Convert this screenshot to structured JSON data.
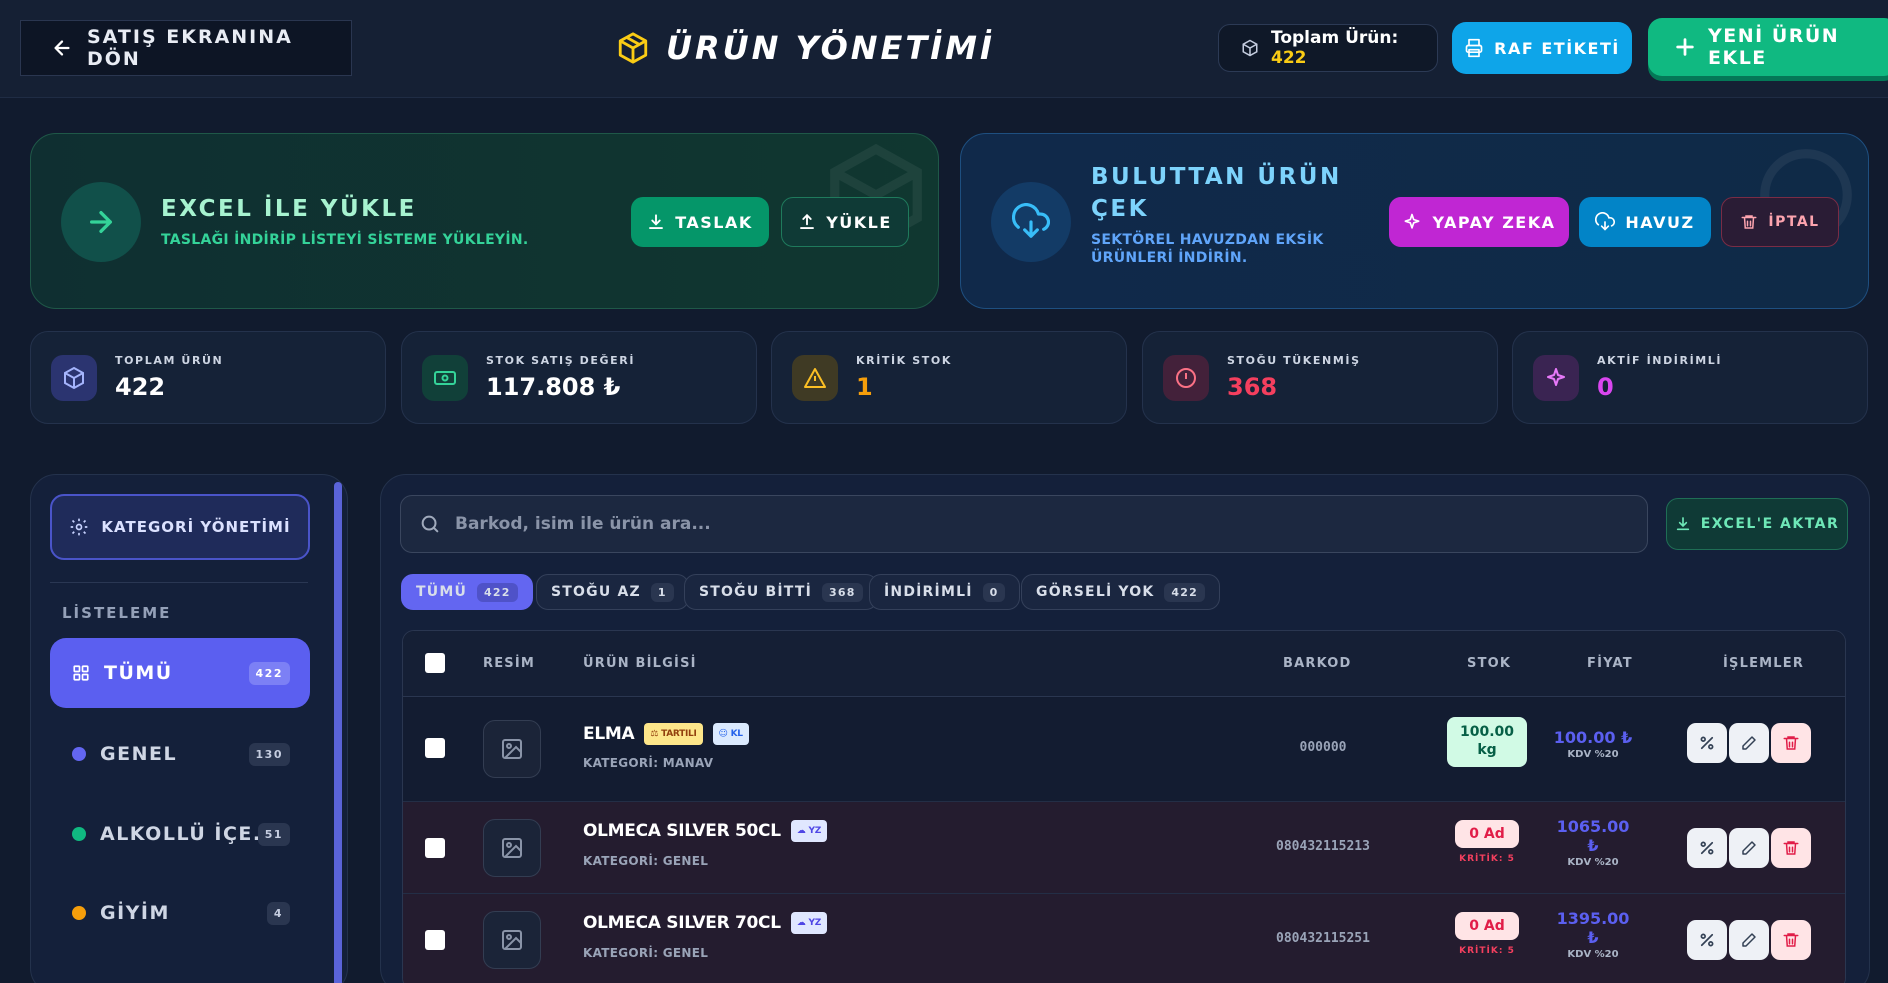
{
  "header": {
    "back_label": "SATIŞ EKRANINA DÖN",
    "title": "ÜRÜN YÖNETİMİ",
    "total_label": "Toplam Ürün:",
    "total_value": "422",
    "shelf_label": "RAF ETİKETİ",
    "new_label": "YENİ ÜRÜN EKLE"
  },
  "excel_banner": {
    "title": "EXCEL İLE YÜKLE",
    "subtitle": "TASLAĞI İNDİRİP LİSTEYİ SİSTEME YÜKLEYİN.",
    "template_label": "TASLAK",
    "upload_label": "YÜKLE"
  },
  "cloud_banner": {
    "title_line1": "BULUTTAN ÜRÜN",
    "title_line2": "ÇEK",
    "subtitle_line1": "SEKTÖREL HAVUZDAN EKSİK",
    "subtitle_line2": "ÜRÜNLERİ İNDİRİN.",
    "ai_label": "YAPAY ZEKA",
    "pool_label": "HAVUZ",
    "cancel_label": "İPTAL"
  },
  "stats": [
    {
      "label": "TOPLAM ÜRÜN",
      "value": "422",
      "icon": "cube-icon",
      "color": "#ffffff"
    },
    {
      "label": "STOK SATIŞ DEĞERİ",
      "value": "117.808 ₺",
      "icon": "money-icon",
      "color": "#ffffff"
    },
    {
      "label": "KRİTİK STOK",
      "value": "1",
      "icon": "warning-icon",
      "color": "#f59e0b"
    },
    {
      "label": "STOĞU TÜKENMİŞ",
      "value": "368",
      "icon": "alert-circle-icon",
      "color": "#f43f5e"
    },
    {
      "label": "AKTİF İNDİRİMLİ",
      "value": "0",
      "icon": "sparkle-icon",
      "color": "#d946ef"
    }
  ],
  "sidebar": {
    "category_mgmt_label": "KATEGORİ YÖNETİMİ",
    "list_label": "LİSTELEME",
    "items": [
      {
        "label": "TÜMÜ",
        "count": "422"
      },
      {
        "label": "GENEL",
        "count": "130",
        "color": "#6366f1"
      },
      {
        "label": "ALKOLLÜ İÇE...",
        "count": "51",
        "color": "#10b981"
      },
      {
        "label": "GİYİM",
        "count": "4",
        "color": "#f59e0b"
      }
    ]
  },
  "search": {
    "placeholder": "Barkod, isim ile ürün ara..."
  },
  "export_label": "EXCEL'E AKTAR",
  "filters": [
    {
      "label": "TÜMÜ",
      "count": "422"
    },
    {
      "label": "STOĞU AZ",
      "count": "1"
    },
    {
      "label": "STOĞU BİTTİ",
      "count": "368"
    },
    {
      "label": "İNDİRİMLİ",
      "count": "0"
    },
    {
      "label": "GÖRSELİ YOK",
      "count": "422"
    }
  ],
  "table": {
    "headers": [
      "RESİM",
      "ÜRÜN BİLGİSİ",
      "BARKOD",
      "STOK",
      "FİYAT",
      "İŞLEMLER"
    ],
    "rows": [
      {
        "name": "ELMA",
        "tag1": "TARTILI",
        "tag2": "KL",
        "category": "KATEGORİ: MANAV",
        "barcode": "000000",
        "stock_line1": "100.00",
        "stock_line2": "kg",
        "price_line1": "100.00 ₺",
        "price_line2": "",
        "kdv": "KDV %20"
      },
      {
        "name": "OLMECA SILVER 50CL",
        "tag2": "YZ",
        "category": "KATEGORİ: GENEL",
        "barcode": "080432115213",
        "stock_line1": "0 Ad",
        "critical": "KRİTİK: 5",
        "price_line1": "1065.00",
        "price_line2": "₺",
        "kdv": "KDV %20"
      },
      {
        "name": "OLMECA SILVER 70CL",
        "tag2": "YZ",
        "category": "KATEGORİ: GENEL",
        "barcode": "080432115251",
        "stock_line1": "0 Ad",
        "critical": "KRİTİK: 5",
        "price_line1": "1395.00",
        "price_line2": "₺",
        "kdv": "KDV %20"
      }
    ]
  },
  "colors": {
    "accent": "#6366f1",
    "green": "#10b981",
    "blue": "#0ea5e9",
    "magenta": "#c026d3"
  }
}
